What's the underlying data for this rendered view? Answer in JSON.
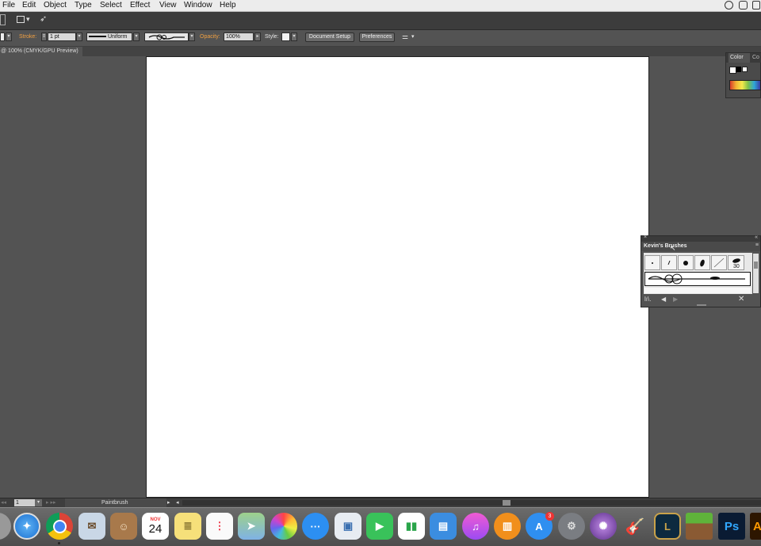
{
  "menubar": {
    "items": [
      "File",
      "Edit",
      "Object",
      "Type",
      "Select",
      "Effect",
      "View",
      "Window",
      "Help"
    ]
  },
  "control": {
    "stroke_label": "Stroke:",
    "stroke_value": "1 pt",
    "profile_value": "Uniform",
    "opacity_label": "Opacity:",
    "opacity_value": "100%",
    "style_label": "Style:",
    "document_setup": "Document Setup",
    "preferences": "Preferences"
  },
  "document": {
    "tab_title": "@ 100% (CMYK/GPU Preview)"
  },
  "color_panel": {
    "tab_active": "Color",
    "tab_other": "Co"
  },
  "brushes_panel": {
    "title": "Kevin's Brushes",
    "brush_size_label": "30"
  },
  "statusbar": {
    "artboard_number": "1",
    "tool": "Paintbrush"
  },
  "dock": {
    "calendar_month": "NOV",
    "calendar_day": "24",
    "appstore_badge": "3",
    "photoshop_label": "Ps",
    "illustrator_label": "Ai"
  },
  "icons": [
    "safari-icon",
    "chrome-icon",
    "mail-icon",
    "contacts-icon",
    "calendar-icon",
    "notes-icon",
    "reminders-icon",
    "maps-icon",
    "photos-icon",
    "messages-icon",
    "preview-icon",
    "facetime-icon",
    "numbers-icon",
    "keynote-icon",
    "itunes-icon",
    "ibooks-icon",
    "appstore-icon",
    "system-preferences-icon",
    "motion-icon",
    "garageband-icon",
    "league-of-legends-icon",
    "minecraft-icon",
    "photoshop-icon",
    "illustrator-icon"
  ],
  "colors": {
    "ui_dark": "#535353",
    "orange_label": "#f0a042",
    "artboard": "#ffffff"
  }
}
